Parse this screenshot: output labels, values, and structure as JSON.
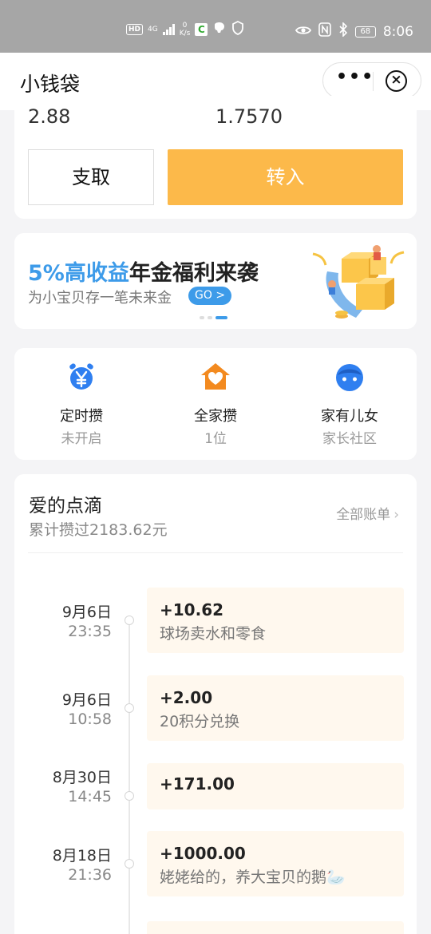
{
  "status_bar": {
    "hd": "HD",
    "network": "4G",
    "netspeed_value": "0",
    "netspeed_unit": "K/s",
    "battery": "68",
    "time": "8:06"
  },
  "title_bar": {
    "title": "小钱袋",
    "more_label": "•••",
    "close_label": "×"
  },
  "balance": {
    "left_value": "2.88",
    "right_value": "1.7570",
    "withdraw_label": "支取",
    "transfer_label": "转入"
  },
  "banner": {
    "highlight": "5%高收益",
    "headline_rest": "年金福利来袭",
    "subtitle": "为小宝贝存一笔未来金",
    "go_label": "GO >",
    "colors": {
      "highlight": "#3d9be9"
    }
  },
  "menu": [
    {
      "label": "定时攒",
      "sub": "未开启",
      "icon": "alarm-yen-icon",
      "color": "#2f7ff0"
    },
    {
      "label": "全家攒",
      "sub": "1位",
      "icon": "house-heart-icon",
      "color": "#f38a1f"
    },
    {
      "label": "家有儿女",
      "sub": "家长社区",
      "icon": "child-face-icon",
      "color": "#2f7ff0"
    }
  ],
  "feed": {
    "title": "爱的点滴",
    "subtitle": "累计攒过2183.62元",
    "all_bills_label": "全部账单",
    "chevron": "›",
    "items": [
      {
        "date": "9月6日",
        "time": "23:35",
        "amount": "+10.62",
        "note": "球场卖水和零食"
      },
      {
        "date": "9月6日",
        "time": "10:58",
        "amount": "+2.00",
        "note": "20积分兑换"
      },
      {
        "date": "8月30日",
        "time": "14:45",
        "amount": "+171.00",
        "note": ""
      },
      {
        "date": "8月18日",
        "time": "21:36",
        "amount": "+1000.00",
        "note": "姥姥给的，养大宝贝的鹅🦢"
      }
    ]
  },
  "colors": {
    "accent_orange": "#fcb94a",
    "accent_blue": "#3d9be9"
  }
}
